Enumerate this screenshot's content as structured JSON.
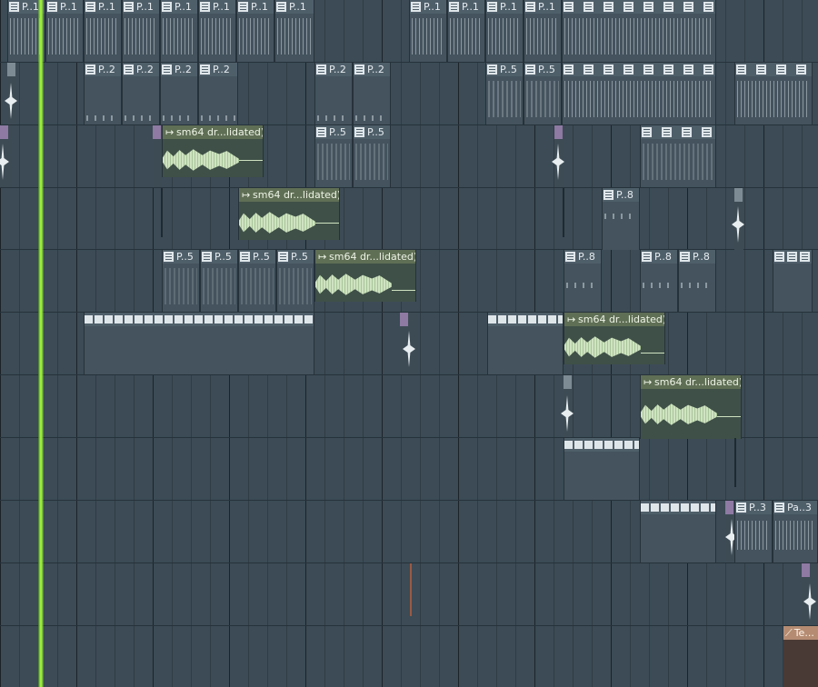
{
  "labels": {
    "p1": "P..1",
    "p2": "P..2",
    "p3": "P..3",
    "pa3": "Pa..3",
    "p5": "P..5",
    "p8": "P..8",
    "audio": "sm64 dr...lidated)",
    "auto": "Te..."
  },
  "colors": {
    "background": "#3c4b56",
    "playhead": "#9cf038",
    "pattern_header": "#4f5f6a",
    "audio_header": "#5f6f55",
    "automation_header": "#b58c72"
  },
  "icons": {
    "pattern": "pattern-icon",
    "audio": "audio-clip-arrow-icon",
    "automation": "automation-curve-icon"
  }
}
